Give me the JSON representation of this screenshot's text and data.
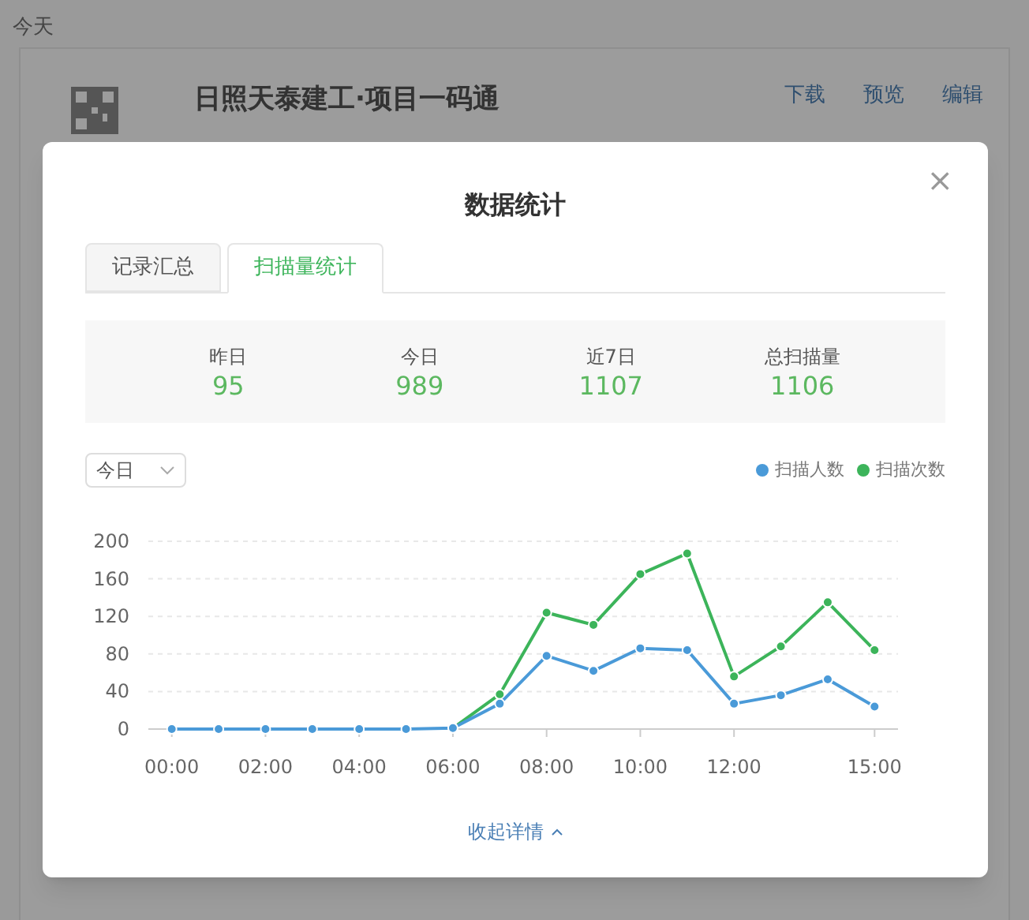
{
  "page": {
    "section_title": "今天",
    "project": {
      "title": "日照天泰建工·项目一码通",
      "actions": [
        "下载",
        "预览",
        "编辑"
      ]
    }
  },
  "dialog": {
    "title": "数据统计",
    "close": "×",
    "tabs": [
      {
        "label": "记录汇总",
        "selected": false
      },
      {
        "label": "扫描量统计",
        "selected": true
      }
    ],
    "stats": [
      {
        "label": "昨日",
        "value": "95"
      },
      {
        "label": "今日",
        "value": "989"
      },
      {
        "label": "近7日",
        "value": "1107"
      },
      {
        "label": "总扫描量",
        "value": "1106"
      }
    ],
    "range_select": {
      "value": "今日"
    },
    "chart_data": {
      "type": "line",
      "x": [
        0,
        1,
        2,
        3,
        4,
        5,
        6,
        7,
        8,
        9,
        10,
        11,
        12,
        13,
        14,
        15
      ],
      "series": [
        {
          "name": "扫描人数",
          "color": "#4a9ad8",
          "marker": "circle",
          "values": [
            0,
            0,
            0,
            0,
            0,
            0,
            1,
            27,
            78,
            62,
            86,
            84,
            27,
            36,
            53,
            24
          ]
        },
        {
          "name": "扫描次数",
          "color": "#3cb45a",
          "marker": "circle",
          "values": [
            null,
            null,
            null,
            null,
            null,
            null,
            1,
            37,
            124,
            111,
            165,
            187,
            56,
            88,
            135,
            84
          ]
        }
      ],
      "xlim": [
        -0.5,
        15.5
      ],
      "ylim": [
        0,
        200
      ],
      "grid": true,
      "yticks": [
        0,
        40,
        80,
        120,
        160,
        200
      ],
      "xticks": [
        {
          "value": 0,
          "label": "00:00"
        },
        {
          "value": 2,
          "label": "02:00"
        },
        {
          "value": 4,
          "label": "04:00"
        },
        {
          "value": 6,
          "label": "06:00"
        },
        {
          "value": 8,
          "label": "08:00"
        },
        {
          "value": 10,
          "label": "10:00"
        },
        {
          "value": 12,
          "label": "12:00"
        },
        {
          "value": 15,
          "label": "15:00"
        }
      ]
    },
    "collapse_link": "收起详情"
  }
}
